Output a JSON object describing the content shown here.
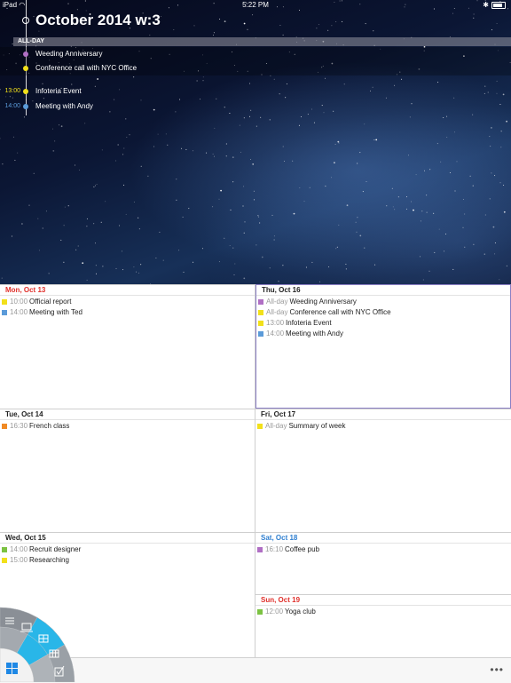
{
  "status_bar": {
    "carrier": "iPad",
    "time": "5:22 PM"
  },
  "header": {
    "title": "October 2014 w:3",
    "allday_label": "ALL-DAY"
  },
  "agenda": [
    {
      "time": "",
      "label": "Weeding Anniversary",
      "color": "#b06fc4",
      "allday": true
    },
    {
      "time": "",
      "label": "Conference call with NYC Office",
      "color": "#f2e01a",
      "allday": true
    },
    {
      "time": "13:00",
      "label": "Infoteria Event",
      "color": "#f2e01a",
      "allday": false
    },
    {
      "time": "14:00",
      "label": "Meeting with Andy",
      "color": "#5b9bd9",
      "allday": false
    }
  ],
  "days": {
    "mon": {
      "label": "Mon, Oct 13",
      "events": [
        {
          "time": "10:00",
          "title": "Official report",
          "color": "#f2e01a"
        },
        {
          "time": "14:00",
          "title": "Meeting with Ted",
          "color": "#5b9bd9"
        }
      ]
    },
    "thu": {
      "label": "Thu, Oct 16",
      "events": [
        {
          "time": "All-day",
          "title": "Weeding Anniversary",
          "color": "#b06fc4"
        },
        {
          "time": "All-day",
          "title": "Conference call with NYC Office",
          "color": "#f2e01a"
        },
        {
          "time": "13:00",
          "title": "Infoteria Event",
          "color": "#f2e01a"
        },
        {
          "time": "14:00",
          "title": "Meeting with Andy",
          "color": "#5b9bd9"
        }
      ]
    },
    "tue": {
      "label": "Tue, Oct 14",
      "events": [
        {
          "time": "16:30",
          "title": "French class",
          "color": "#f08a24"
        }
      ]
    },
    "fri": {
      "label": "Fri, Oct 17",
      "events": [
        {
          "time": "All-day",
          "title": "Summary of week",
          "color": "#f2e01a"
        }
      ]
    },
    "wed": {
      "label": "Wed, Oct 15",
      "events": [
        {
          "time": "14:00",
          "title": "Recruit designer",
          "color": "#7cc242"
        },
        {
          "time": "15:00",
          "title": "Researching",
          "color": "#f2e01a"
        }
      ]
    },
    "sat": {
      "label": "Sat, Oct 18",
      "events": [
        {
          "time": "16:10",
          "title": "Coffee pub",
          "color": "#b06fc4"
        }
      ]
    },
    "sun": {
      "label": "Sun, Oct 19",
      "events": [
        {
          "time": "12:00",
          "title": "Yoga club",
          "color": "#7cc242"
        }
      ]
    }
  },
  "toolbar": {
    "more_label": "•••"
  },
  "colors": {
    "today_border": "#8b7fc4",
    "weekend_red": "#e0302b",
    "saturday_blue": "#2f7fd0",
    "wheel_active": "#29b6e8",
    "home_icon": "#1e88e5"
  }
}
